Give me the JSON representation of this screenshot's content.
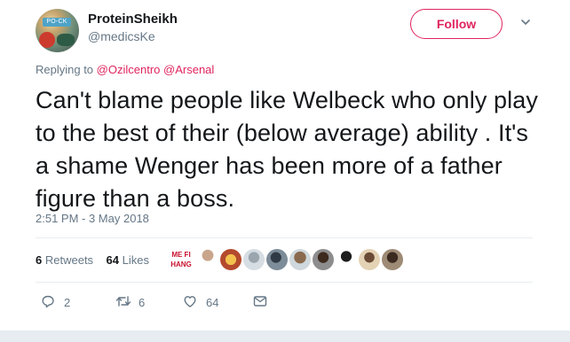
{
  "user": {
    "name": "ProteinSheikh",
    "handle": "@medicsKe",
    "avatar_brand": "PO-CK"
  },
  "follow_label": "Follow",
  "reply": {
    "prefix": "Replying to",
    "mention_1": "@Ozilcentro",
    "mention_2": "@Arsenal"
  },
  "tweet": {
    "text": "Can't blame people like Welbeck who only play to the best of their (below average) ability . It's a shame Wenger has been more of a father figure than a boss.",
    "timestamp": "2:51 PM - 3 May 2018"
  },
  "stats": {
    "retweets_count": "6",
    "retweets_label": "Retweets",
    "likes_count": "64",
    "likes_label": "Likes",
    "liker_banner_text_1": "ME FI",
    "liker_banner_text_2": "HANG"
  },
  "actions": {
    "reply_count": "2",
    "retweet_count": "6",
    "like_count": "64"
  },
  "colors": {
    "accent": "#e0245e",
    "secondary_text": "#657786",
    "primary_text": "#14171a",
    "divider": "#e6ecf0"
  },
  "icons": {
    "chevron": "chevron-down-icon",
    "reply": "reply-icon",
    "retweet": "retweet-icon",
    "like": "heart-icon",
    "message": "direct-message-icon"
  }
}
